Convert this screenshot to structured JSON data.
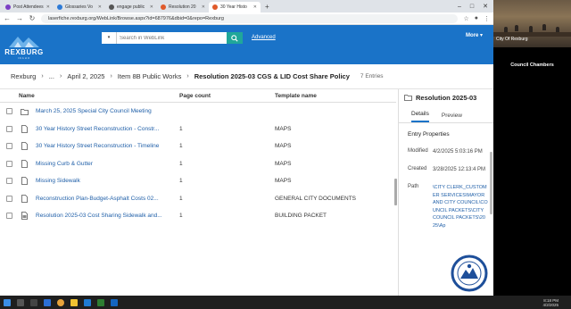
{
  "browser": {
    "tabs": [
      {
        "label": "Post Attendees",
        "color": "#7b3fc4",
        "active": false
      },
      {
        "label": "Glossaries Vo",
        "color": "#2d7ad6",
        "active": false
      },
      {
        "label": "engage public",
        "color": "#555555",
        "active": false
      },
      {
        "label": "Resolution 20",
        "color": "#e05a2b",
        "active": false
      },
      {
        "label": "30 Year Histo",
        "color": "#e05a2b",
        "active": true
      }
    ],
    "new_tab": "+",
    "url": "laserfiche.rexburg.org/WebLink/Browse.aspx?id=687976&dbid=0&repo=Rexburg"
  },
  "site": {
    "logo_name": "REXBURG",
    "logo_sub": "IDAHO",
    "search_type": "▾",
    "search_placeholder": "Search in WebLink",
    "advanced_label": "Advanced",
    "more_label": "More ▾"
  },
  "breadcrumb": {
    "items": [
      "Rexburg",
      "...",
      "April 2, 2025",
      "Item 8B Public Works"
    ],
    "current": "Resolution 2025-03 CGS & LID Cost Share Policy",
    "entry_count": "7 Entries"
  },
  "table": {
    "headers": {
      "name": "Name",
      "pages": "Page count",
      "template": "Template name"
    },
    "rows": [
      {
        "name": "March 25, 2025 Special City Council Meeting",
        "pages": "",
        "template": "",
        "kind": "folder"
      },
      {
        "name": "30 Year History Street Reconstruction - Constr...",
        "pages": "1",
        "template": "MAPS",
        "kind": "doc"
      },
      {
        "name": "30 Year History Street Reconstruction - Timeline",
        "pages": "1",
        "template": "MAPS",
        "kind": "doc"
      },
      {
        "name": "Missing Curb & Gutter",
        "pages": "1",
        "template": "MAPS",
        "kind": "doc"
      },
      {
        "name": "Missing Sidewalk",
        "pages": "1",
        "template": "MAPS",
        "kind": "doc"
      },
      {
        "name": "Reconstruction Plan-Budget-Asphalt Costs 02...",
        "pages": "1",
        "template": "GENERAL CITY DOCUMENTS",
        "kind": "doc"
      },
      {
        "name": "Resolution 2025-03 Cost Sharing Sidewalk and...",
        "pages": "1",
        "template": "BUILDING PACKET",
        "kind": "pdf"
      }
    ]
  },
  "panel": {
    "title": "Resolution 2025-03",
    "tabs": [
      "Details",
      "Preview"
    ],
    "section": "Entry Properties",
    "modified_label": "Modified",
    "modified_value": "4/2/2025 5:03:16 PM",
    "created_label": "Created",
    "created_value": "3/28/2025 12:13:4 PM",
    "path_label": "Path",
    "path_value": "\\CITY CLERK_CUSTOMER SERVICES\\MAYOR AND CITY COUNCIL\\COUNCIL PACKETS\\CITY COUNCIL PACKETS\\2025\\Ap"
  },
  "taskbar": {
    "time": "8:18 PM",
    "date": "4/2/2025"
  },
  "zoom": {
    "video_label": "City Of Rexburg",
    "room_label": "Council Chambers"
  }
}
